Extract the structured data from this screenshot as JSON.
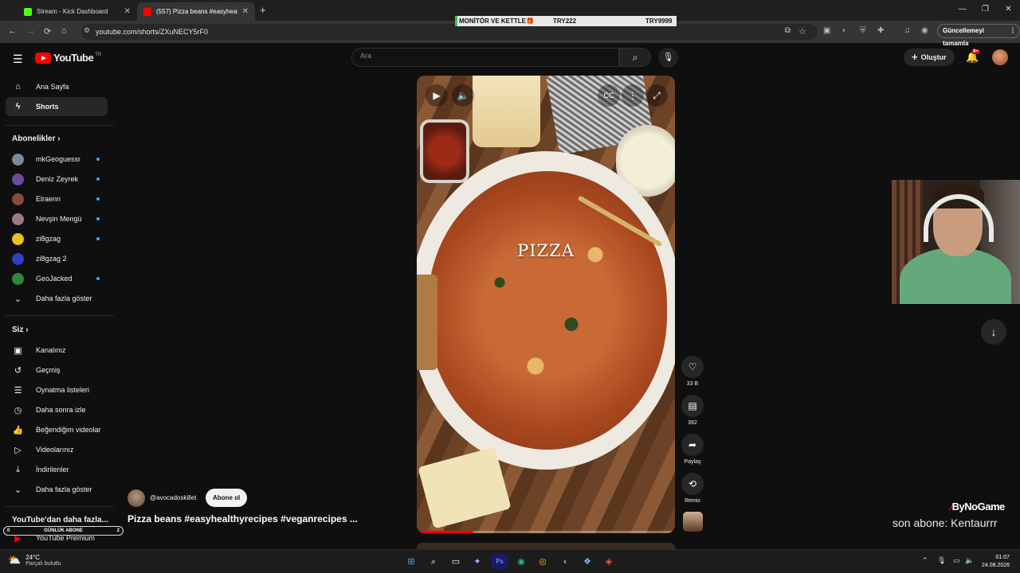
{
  "browser": {
    "tabs": [
      {
        "title": "Stream - Kick Dashboard",
        "favicon_color": "#53fc18"
      },
      {
        "title": "(557) Pizza beans #easyhealthy",
        "favicon_color": "#ff0000"
      }
    ],
    "url": "youtube.com/shorts/ZXuNECY5rF0",
    "update_button": "Güncellemeyi tamamla",
    "ticker": {
      "item": "MONİTÖR VE KETTLE🎁",
      "value_a": "TRY222",
      "value_b": "TRY9999"
    }
  },
  "masthead": {
    "logo_text": "YouTube",
    "country_code": "TR",
    "search_placeholder": "Ara",
    "create_label": "Oluştur",
    "notification_count": "9+"
  },
  "sidebar": {
    "main": [
      {
        "label": "Ana Sayfa",
        "icon": "home-icon"
      },
      {
        "label": "Shorts",
        "icon": "shorts-icon"
      }
    ],
    "subscriptions_heading": "Abonelikler",
    "subscriptions": [
      {
        "label": "mkGeoguessr",
        "color": "#7a8a9a"
      },
      {
        "label": "Deniz Zeyrek",
        "color": "#6b4c9a"
      },
      {
        "label": "Elraenn",
        "color": "#8a4a3a"
      },
      {
        "label": "Nevşin Mengü",
        "color": "#9a7a8a"
      },
      {
        "label": "zi8gzag",
        "color": "#e8c020"
      },
      {
        "label": "zi8gzag 2",
        "color": "#3040c0"
      },
      {
        "label": "GeoJacked",
        "color": "#2a8a3a"
      }
    ],
    "subs_show_more": "Daha fazla göster",
    "you_heading": "Siz",
    "you_items": [
      {
        "label": "Kanalınız",
        "icon": "channel-icon"
      },
      {
        "label": "Geçmiş",
        "icon": "history-icon"
      },
      {
        "label": "Oynatma listeleri",
        "icon": "playlists-icon"
      },
      {
        "label": "Daha sonra izle",
        "icon": "watch-later-icon"
      },
      {
        "label": "Beğendiğim videolar",
        "icon": "liked-icon"
      },
      {
        "label": "Videolarınız",
        "icon": "your-videos-icon"
      },
      {
        "label": "İndirilenler",
        "icon": "downloads-icon"
      }
    ],
    "you_show_more": "Daha fazla göster",
    "more_heading": "YouTube'dan daha fazla...",
    "premium_label": "YouTube Premium"
  },
  "overlay_daily": {
    "left": "0",
    "label": "GÜNLÜK ABONE",
    "right": "2"
  },
  "short": {
    "overlay_word": "PIZZA",
    "progress": 0.22,
    "channel_handle": "@avocadoskillet",
    "subscribe_label": "Abone ol",
    "title": "Pizza beans #easyhealthyrecipes #veganrecipes ..."
  },
  "actions": {
    "likes": "33 B",
    "comments": "392",
    "share": "Paylaş",
    "remix": "Remix"
  },
  "stream": {
    "brand_text": "ByNoGame",
    "sub_notice": "son abone: Kentaurrr"
  },
  "taskbar": {
    "temp": "24°C",
    "weather": "Parçalı bulutlu",
    "time": "01:07",
    "date": "24.08.2026"
  }
}
